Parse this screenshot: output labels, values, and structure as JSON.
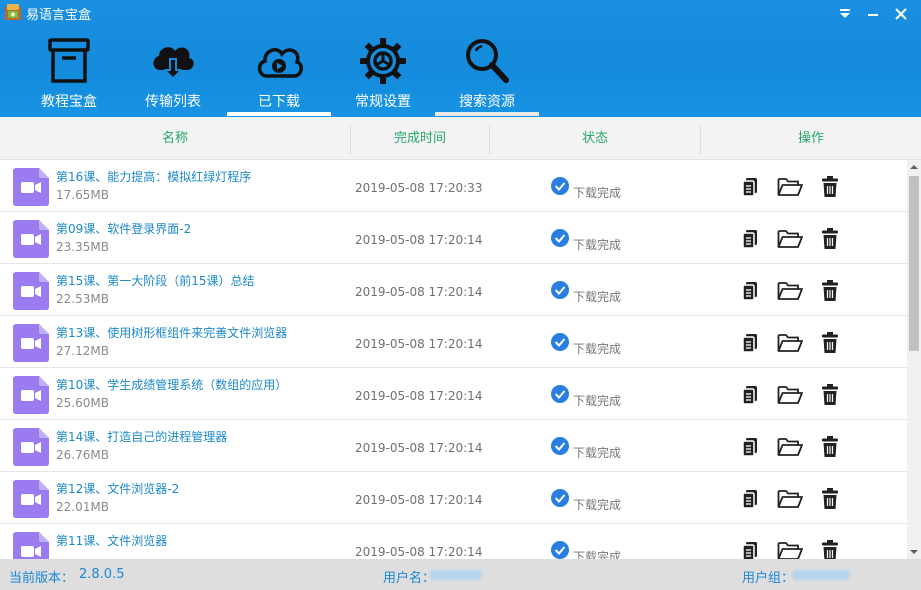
{
  "app": {
    "title": "易语言宝盒",
    "colors": {
      "header": "#148bdc",
      "accent": "#27a86b",
      "link": "#1c88c8",
      "status_ok": "#2a7de1",
      "file_icon": "#9a7cf0"
    }
  },
  "window": {
    "controls": [
      "dropdown-icon",
      "minimize-icon",
      "close-icon"
    ]
  },
  "nav": {
    "tabs": [
      {
        "label": "教程宝盒",
        "icon": "archive-box-icon"
      },
      {
        "label": "传输列表",
        "icon": "cloud-download-icon"
      },
      {
        "label": "已下载",
        "icon": "cloud-play-icon",
        "active": true
      },
      {
        "label": "常规设置",
        "icon": "gear-icon"
      },
      {
        "label": "搜索资源",
        "icon": "search-icon"
      }
    ]
  },
  "columns": {
    "name": "名称",
    "time": "完成时间",
    "status": "状态",
    "actions": "操作"
  },
  "rows": [
    {
      "name": "第16课、能力提高：模拟红绿灯程序",
      "size": "17.65MB",
      "time": "2019-05-08 17:20:33",
      "status": "下载完成"
    },
    {
      "name": "第09课、软件登录界面-2",
      "size": "23.35MB",
      "time": "2019-05-08 17:20:14",
      "status": "下载完成"
    },
    {
      "name": "第15课、第一大阶段（前15课）总结",
      "size": "22.53MB",
      "time": "2019-05-08 17:20:14",
      "status": "下载完成"
    },
    {
      "name": "第13课、使用树形框组件来完善文件浏览器",
      "size": "27.12MB",
      "time": "2019-05-08 17:20:14",
      "status": "下载完成"
    },
    {
      "name": "第10课、学生成绩管理系统（数组的应用）",
      "size": "25.60MB",
      "time": "2019-05-08 17:20:14",
      "status": "下载完成"
    },
    {
      "name": "第14课、打造自己的进程管理器",
      "size": "26.76MB",
      "time": "2019-05-08 17:20:14",
      "status": "下载完成"
    },
    {
      "name": "第12课、文件浏览器-2",
      "size": "22.01MB",
      "time": "2019-05-08 17:20:14",
      "status": "下载完成"
    },
    {
      "name": "第11课、文件浏览器",
      "size": "",
      "time": "2019-05-08 17:20:14",
      "status": "下载完成"
    }
  ],
  "row_actions": [
    "copy-icon",
    "folder-open-icon",
    "trash-icon"
  ],
  "statusbar": {
    "version_label": "当前版本：",
    "version": "2.8.0.5",
    "username_label": "用户名：",
    "usergroup_label": "用户组："
  }
}
